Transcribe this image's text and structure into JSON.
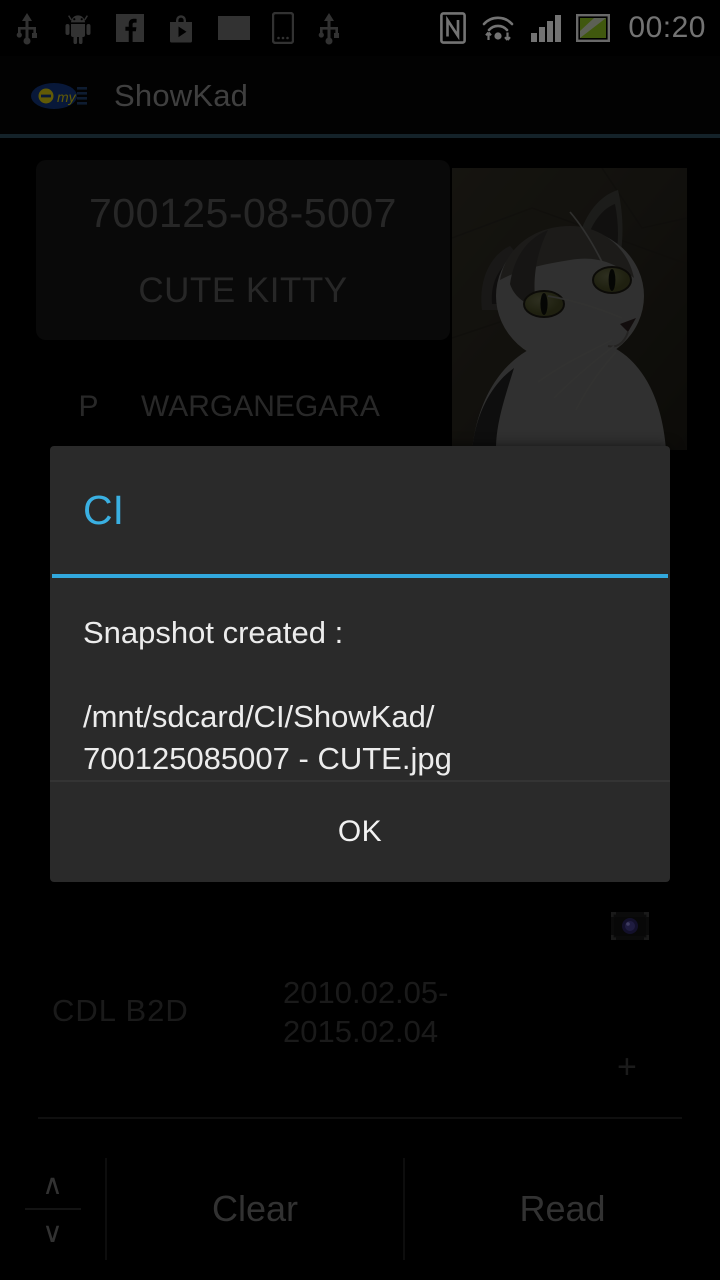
{
  "status_bar": {
    "left_icons": [
      {
        "name": "usb-icon",
        "label": "USB"
      },
      {
        "name": "android-icon",
        "label": "Android"
      },
      {
        "name": "facebook-icon",
        "label": "Facebook"
      },
      {
        "name": "play-store-icon",
        "label": "Play Store"
      },
      {
        "name": "email-icon",
        "label": "Email"
      },
      {
        "name": "sim-card-icon",
        "label": "SIM card"
      },
      {
        "name": "usb-icon-2",
        "label": "USB"
      }
    ],
    "right_icons": [
      {
        "name": "nfc-icon",
        "label": "NFC"
      },
      {
        "name": "wifi-icon",
        "label": "Wi-Fi"
      },
      {
        "name": "cell-signal-icon",
        "label": "Signal"
      },
      {
        "name": "battery-charging-icon",
        "label": "Battery charging"
      }
    ],
    "clock": "00:20"
  },
  "action_bar": {
    "title": "ShowKad",
    "logo_text_primary": "e",
    "logo_text_secondary": "my",
    "underline_color": "#2d4d5c"
  },
  "card": {
    "ic_number": "700125-08-5007",
    "name": "CUTE KITTY",
    "gender_code": "P",
    "citizenship": "WARGANEGARA"
  },
  "lower_fields": {
    "licence_class": "CDL  B2D",
    "validity_period": "2010.02.05-2015.02.04",
    "add_button": "+",
    "camera_icon": "camera-icon"
  },
  "bottom_toolbar": {
    "stepper_up": "∧",
    "stepper_down": "∨",
    "clear_label": "Clear",
    "read_label": "Read"
  },
  "dialog": {
    "title": "CI",
    "message": "Snapshot created :\n\n/mnt/sdcard/CI/ShowKad/\n700125085007 - CUTE.jpg",
    "ok_label": "OK",
    "accent_color": "#32a8dd",
    "background_color": "#2a2a2a"
  }
}
